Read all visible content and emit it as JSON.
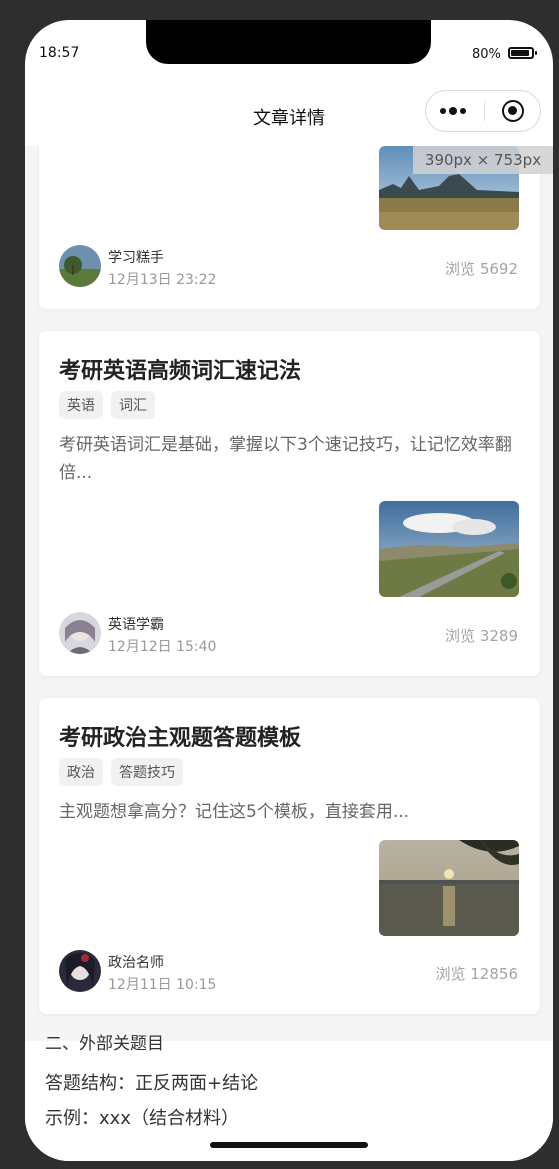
{
  "status_bar": {
    "time": "18:57",
    "battery": "80%",
    "battery_level": 0.8
  },
  "navbar": {
    "title": "文章详情"
  },
  "debug_tooltip": "390px × 753px",
  "articles": [
    {
      "author": "学习糕手",
      "date": "12月13日 23:22",
      "views": "浏览 5692"
    },
    {
      "title": "考研英语高频词汇速记法",
      "tags": [
        "英语",
        "词汇"
      ],
      "excerpt": "考研英语词汇是基础，掌握以下3个速记技巧，让记忆效率翻倍...",
      "author": "英语学霸",
      "date": "12月12日 15:40",
      "views": "浏览 3289"
    },
    {
      "title": "考研政治主观题答题模板",
      "tags": [
        "政治",
        "答题技巧"
      ],
      "excerpt": "主观题想拿高分？记住这5个模板，直接套用...",
      "author": "政治名师",
      "date": "12月11日 10:15",
      "views": "浏览 12856"
    }
  ],
  "detail_content": {
    "clipped_line": "二、外部关题目",
    "lines": [
      "答题结构：正反两面+结论",
      "示例：xxx（结合材料）"
    ]
  },
  "colors": {
    "card_bg": "#ffffff",
    "page_bg": "#f5f5f5",
    "frame_bg": "#2e2e2e"
  }
}
